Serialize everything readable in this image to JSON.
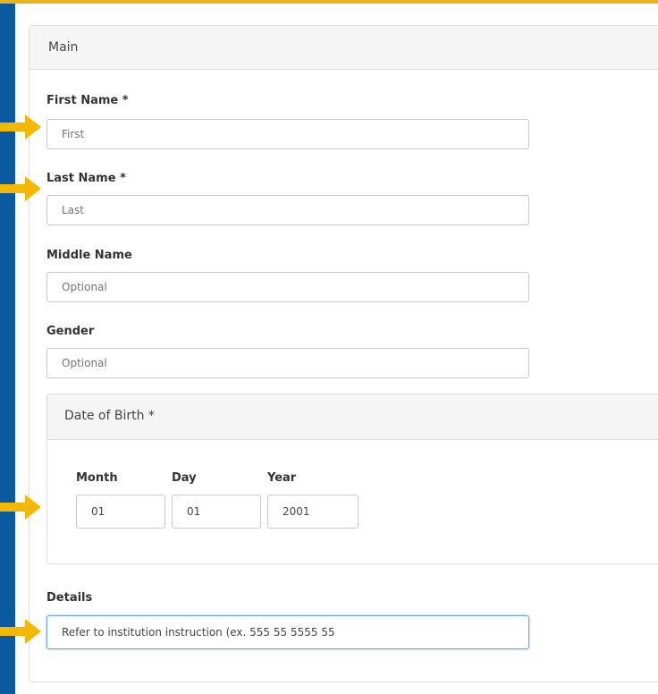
{
  "panel": {
    "title": "Main"
  },
  "form": {
    "first_name": {
      "label": "First Name *",
      "placeholder": "First"
    },
    "last_name": {
      "label": "Last Name *",
      "placeholder": "Last"
    },
    "middle_name": {
      "label": "Middle Name",
      "placeholder": "Optional"
    },
    "gender": {
      "label": "Gender",
      "placeholder": "Optional"
    },
    "dob": {
      "title": "Date of Birth *",
      "month": {
        "label": "Month",
        "value": "01"
      },
      "day": {
        "label": "Day",
        "value": "01"
      },
      "year": {
        "label": "Year",
        "value": "2001"
      }
    },
    "details": {
      "label": "Details",
      "value": "Refer to institution instruction (ex. 555 55 5555 55"
    }
  },
  "colors": {
    "frame": "#0a5aa0",
    "accent": "#e8b41a",
    "arrow": "#f5b800",
    "focus_border": "#6aa7e0"
  },
  "icons": {
    "pointer": "arrow-right-icon"
  }
}
